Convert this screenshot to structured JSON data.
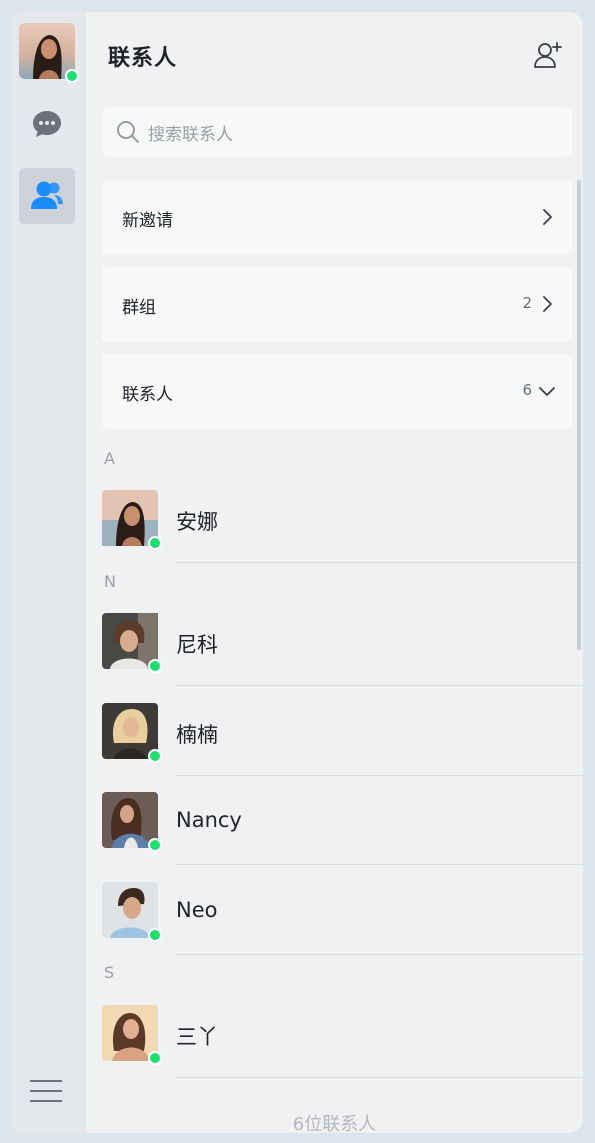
{
  "sidebar": {
    "user_avatar": "user-avatar",
    "chat_icon": "chat-bubble-icon",
    "contacts_icon": "contacts-icon",
    "menu_icon": "hamburger-menu-icon",
    "online_color": "#19e16b",
    "active_color": "#1a8cff"
  },
  "header": {
    "title": "联系人",
    "add_icon": "add-contact-icon"
  },
  "search": {
    "placeholder": "搜索联系人"
  },
  "sections": {
    "new_invites": {
      "label": "新邀请"
    },
    "groups": {
      "label": "群组",
      "count": "2"
    },
    "contacts": {
      "label": "联系人",
      "count": "6"
    }
  },
  "contact_groups": [
    {
      "letter": "A",
      "contacts": [
        {
          "name": "安娜",
          "online": true
        }
      ]
    },
    {
      "letter": "N",
      "contacts": [
        {
          "name": "尼科",
          "online": true
        },
        {
          "name": "楠楠",
          "online": true
        },
        {
          "name": "Nancy",
          "online": true
        },
        {
          "name": "Neo",
          "online": true
        }
      ]
    },
    {
      "letter": "S",
      "contacts": [
        {
          "name": "三丫",
          "online": true
        }
      ]
    }
  ],
  "footer": {
    "count_text": "6位联系人"
  }
}
